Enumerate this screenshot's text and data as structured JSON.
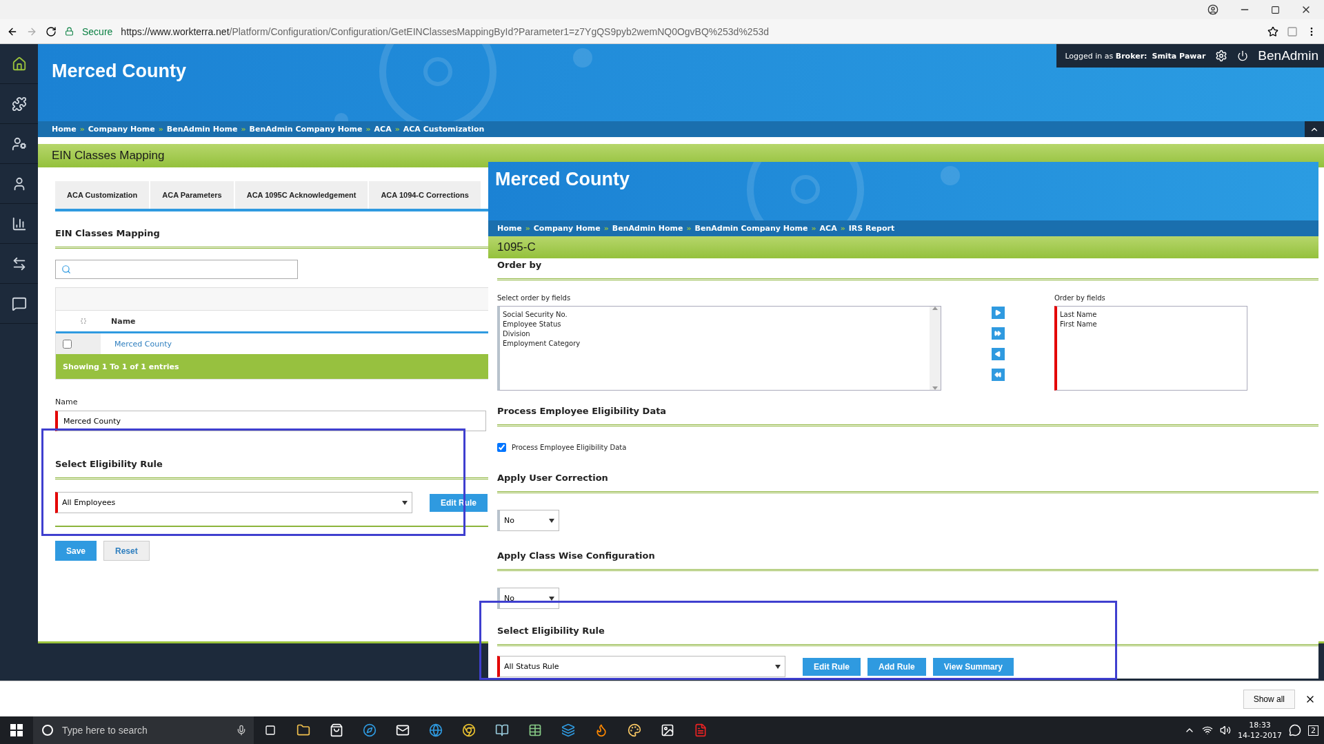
{
  "browser": {
    "secure_label": "Secure",
    "url_host": "https://www.workterra.net",
    "url_path": "/Platform/Configuration/Configuration/GetEINClassesMappingById?Parameter1=z7YgQS9pyb2wemNQ0OgvBQ%253d%253d"
  },
  "app": {
    "login_prefix": "Logged in as",
    "login_role": "Broker:",
    "login_name": "Smita Pawar",
    "brand": "BenAdmin",
    "company": "Merced County",
    "breadcrumb_separator": "»",
    "breadcrumbs": [
      "Home",
      "Company Home",
      "BenAdmin Home",
      "BenAdmin Company Home",
      "ACA",
      "ACA Customization"
    ],
    "page_title": "EIN Classes Mapping",
    "tabs": [
      {
        "label": "ACA Customization",
        "selected": false
      },
      {
        "label": "ACA Parameters",
        "selected": false
      },
      {
        "label": "ACA 1095C Acknowledgement",
        "selected": false
      },
      {
        "label": "ACA 1094-C Corrections",
        "selected": false
      }
    ],
    "section_title": "EIN Classes Mapping",
    "table": {
      "columns": [
        "Name"
      ],
      "rows": [
        {
          "name": "Merced County",
          "checked": false
        }
      ],
      "footer": "Showing 1 To 1 of 1 entries"
    },
    "name_field": {
      "label": "Name",
      "value": "Merced County"
    },
    "eligibility": {
      "title": "Select Eligibility Rule",
      "value": "All Employees",
      "button": "Edit Rule"
    },
    "actions": [
      "Save",
      "Reset"
    ]
  },
  "overlay": {
    "company": "Merced County",
    "breadcrumbs": [
      "Home",
      "Company Home",
      "BenAdmin Home",
      "BenAdmin Company Home",
      "ACA",
      "IRS Report"
    ],
    "page_title": "1095-C",
    "order_by": {
      "title": "Order by",
      "available_label": "Select order by fields",
      "available": [
        "Social Security No.",
        "Employee Status",
        "Division",
        "Employment Category"
      ],
      "selected_label": "Order by fields",
      "selected": [
        "Last Name",
        "First Name"
      ]
    },
    "process": {
      "title": "Process Employee Eligibility Data",
      "checkbox_label": "Process Employee Eligibility Data",
      "checked": true
    },
    "user_correction": {
      "title": "Apply User Correction",
      "value": "No"
    },
    "class_wise": {
      "title": "Apply Class Wise Configuration",
      "value": "No"
    },
    "eligibility": {
      "title": "Select Eligibility Rule",
      "value": "All Status Rule",
      "buttons": [
        "Edit Rule",
        "Add Rule",
        "View Summary"
      ]
    }
  },
  "download_bar": {
    "button": "Show all"
  },
  "taskbar": {
    "search_placeholder": "Type here to search",
    "time": "18:33",
    "date": "14-12-2017",
    "notifications": "2"
  }
}
